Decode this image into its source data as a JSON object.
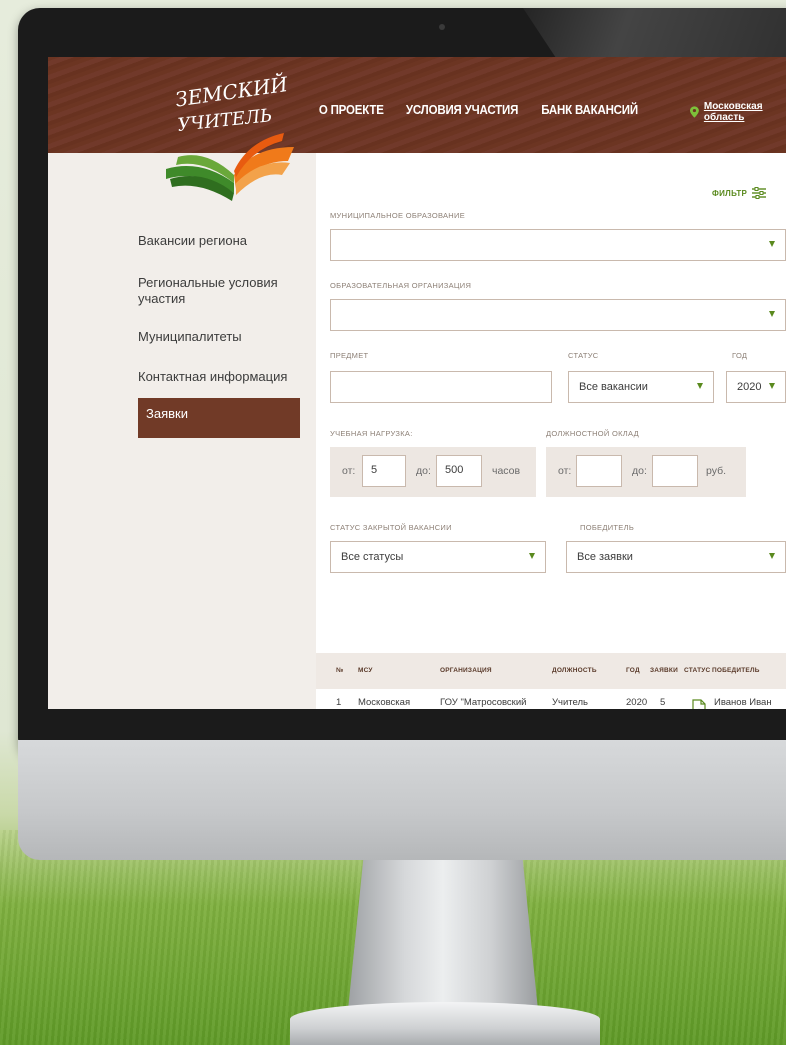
{
  "nav": {
    "items": [
      "О ПРОЕКТЕ",
      "УСЛОВИЯ УЧАСТИЯ",
      "БАНК ВАКАНСИЙ"
    ],
    "region": "Московская область"
  },
  "logo": {
    "text_line1": "ЗЕМСКИЙ",
    "text_line2": "УЧИТЕЛЬ"
  },
  "sidebar": {
    "items": [
      {
        "label": "Вакансии региона",
        "active": false
      },
      {
        "label": "Региональные условия участия",
        "active": false
      },
      {
        "label": "Муниципалитеты",
        "active": false
      },
      {
        "label": "Контактная информация",
        "active": false
      },
      {
        "label": "Заявки",
        "active": true
      }
    ]
  },
  "filters": {
    "filter_label": "ФИЛЬТР",
    "municipality_label": "МУНИЦИПАЛЬНОЕ ОБРАЗОВАНИЕ",
    "municipality_value": "",
    "organization_label": "ОБРАЗОВАТЕЛЬНАЯ ОРГАНИЗАЦИЯ",
    "organization_value": "",
    "subject_label": "ПРЕДМЕТ",
    "subject_value": "",
    "status_label": "СТАТУС",
    "status_value": "Все вакансии",
    "year_label": "ГОД",
    "year_value": "2020",
    "load_label": "УЧЕБНАЯ НАГРУЗКА:",
    "load_from_label": "от:",
    "load_from_value": "5",
    "load_to_label": "до:",
    "load_to_value": "500",
    "load_unit": "часов",
    "salary_label": "ДОЛЖНОСТНОЙ ОКЛАД",
    "salary_from_label": "от:",
    "salary_from_value": "",
    "salary_to_label": "до:",
    "salary_to_value": "",
    "salary_unit": "руб.",
    "closed_status_label": "СТАТУС ЗАКРЫТОЙ ВАКАНСИИ",
    "closed_status_value": "Все статусы",
    "winner_label": "ПОБЕДИТЕЛЬ",
    "winner_value": "Все заявки"
  },
  "table": {
    "columns": [
      "№",
      "МСУ",
      "ОРГАНИЗАЦИЯ",
      "ДОЛЖНОСТЬ",
      "ГОД",
      "ЗАЯВКИ",
      "СТАТУС",
      "ПОБЕДИТЕЛЬ"
    ],
    "rows": [
      {
        "num": "1",
        "msu": "Московская область, деревня Путилково",
        "organization": "ГОУ \"Матросовский специальный (коррекционный) общеобразовательный детский дом\"",
        "position": "Учитель обществознания и права",
        "year": "2020",
        "applications": "5",
        "status_icon": "document-icon",
        "winner": "Иванов Иван Иванович"
      }
    ]
  },
  "colors": {
    "header_brown": "#6c3522",
    "accent_green": "#5a8a1e",
    "active_item": "#713a27",
    "logo_orange": "#f07a1a",
    "logo_green": "#3f8a2a"
  }
}
